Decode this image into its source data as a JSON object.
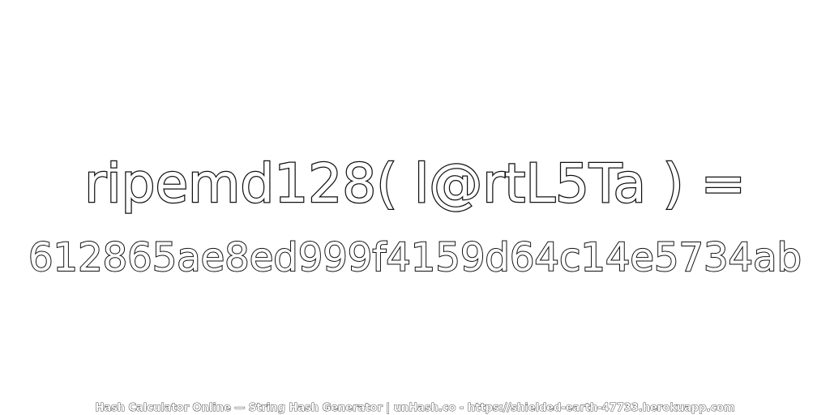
{
  "expression": "ripemd128( l@rtL5Ta ) =",
  "digest": "612865ae8ed999f4159d64c14e5734ab",
  "footer": "Hash Calculator Online — String Hash Generator | unHash.co - https://shielded-earth-47733.herokuapp.com",
  "colors": {
    "background": "#ffffff",
    "text_fill": "#ffffff",
    "text_outline": "#111111"
  }
}
